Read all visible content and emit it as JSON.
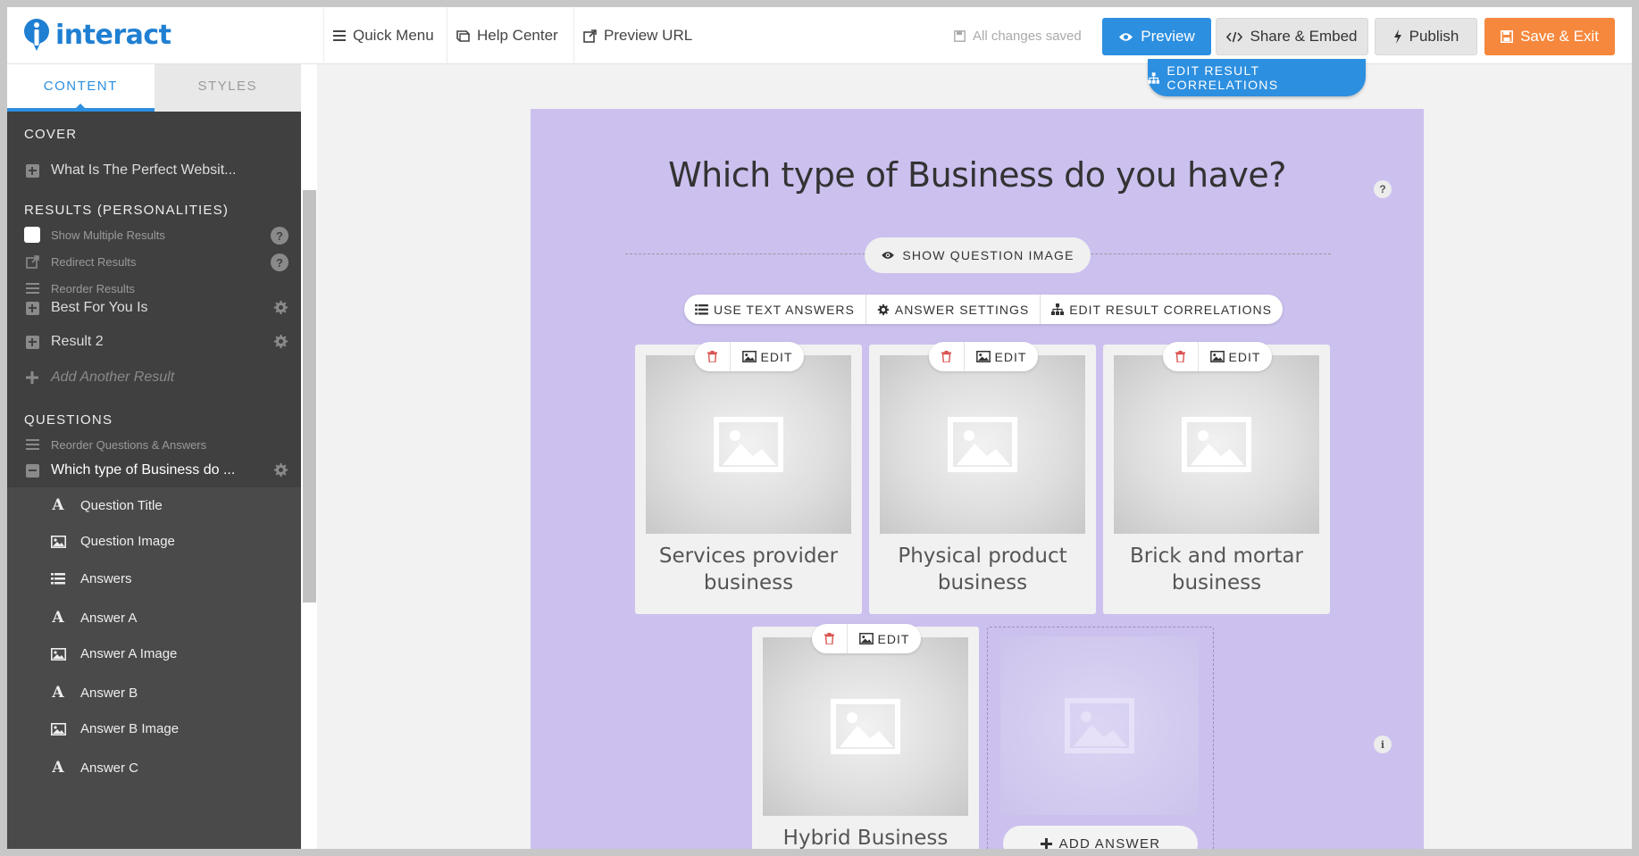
{
  "app": {
    "logo_text": "interact"
  },
  "topbar": {
    "quick_menu": "Quick Menu",
    "help_center": "Help Center",
    "preview_url": "Preview URL",
    "saved_status": "All changes saved",
    "preview": "Preview",
    "share_embed": "Share & Embed",
    "publish": "Publish",
    "save_exit": "Save & Exit"
  },
  "colors": {
    "primary_blue": "#2d8fe0",
    "save_orange": "#f6883d",
    "canvas_lavender": "#ccc0ef",
    "sidebar_dark": "#404040"
  },
  "sidebar": {
    "tabs": [
      "CONTENT",
      "STYLES"
    ],
    "active_tab": "CONTENT",
    "cover": {
      "title": "COVER",
      "item": "What Is The Perfect Websit..."
    },
    "results": {
      "title": "RESULTS (PERSONALITIES)",
      "show_multiple": "Show Multiple Results",
      "redirect": "Redirect Results",
      "reorder": "Reorder Results",
      "items": [
        "Best For You Is",
        "Result 2"
      ],
      "add_another": "Add Another Result"
    },
    "questions": {
      "title": "QUESTIONS",
      "reorder": "Reorder Questions & Answers",
      "current": "Which type of Business do ...",
      "sub_items": [
        {
          "label": "Question Title",
          "icon": "font-icon"
        },
        {
          "label": "Question Image",
          "icon": "image-icon"
        },
        {
          "label": "Answers",
          "icon": "list-icon"
        },
        {
          "label": "Answer A",
          "icon": "font-icon"
        },
        {
          "label": "Answer A Image",
          "icon": "image-icon"
        },
        {
          "label": "Answer B",
          "icon": "font-icon"
        },
        {
          "label": "Answer B Image",
          "icon": "image-icon"
        },
        {
          "label": "Answer C",
          "icon": "font-icon"
        }
      ]
    }
  },
  "main": {
    "edit_result_correlations_top": "EDIT RESULT CORRELATIONS",
    "question_title": "Which type of Business do you have?",
    "help_badge": "?",
    "show_question_image": "SHOW QUESTION IMAGE",
    "answer_toolbar": {
      "use_text_answers": "USE TEXT ANSWERS",
      "answer_settings": "ANSWER SETTINGS",
      "edit_result_correlations": "EDIT RESULT CORRELATIONS"
    },
    "edit_label": "EDIT",
    "answers": [
      {
        "label": "Services provider business"
      },
      {
        "label": "Physical product business"
      },
      {
        "label": "Brick and mortar business"
      },
      {
        "label": "Hybrid Business"
      }
    ],
    "add_answer": "ADD ANSWER",
    "info_badge": "i"
  }
}
